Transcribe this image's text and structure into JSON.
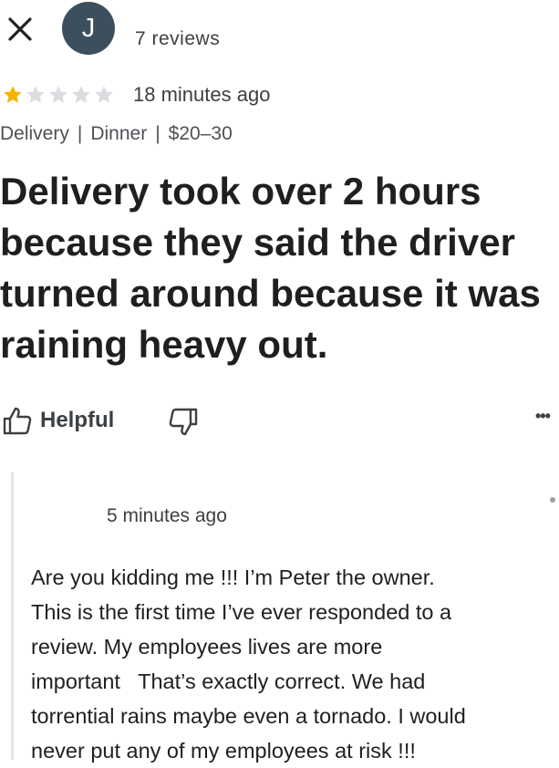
{
  "header": {
    "close_icon": "close-icon",
    "avatar_initial": "J",
    "review_count": "7 reviews"
  },
  "review": {
    "rating": 1,
    "rating_max": 5,
    "star_filled_color": "#f4b400",
    "star_empty_color": "#dadce0",
    "time_ago": "18 minutes ago",
    "tags": [
      "Delivery",
      "Dinner",
      "$20–30"
    ],
    "text_lines": [
      "Delivery took over 2 hours",
      "because they said the driver",
      "turned around because it was",
      "raining heavy out."
    ]
  },
  "actions": {
    "helpful_label": "Helpful",
    "thumb_up_icon": "thumb-up-icon",
    "thumb_down_icon": "thumb-down-icon",
    "more_label": "•••"
  },
  "owner_reply": {
    "time_ago": "5 minutes ago",
    "text_lines": [
      "Are you kidding me !!! I’m Peter the owner.",
      "This is the first time I’ve ever responded to a",
      "review. My employees lives are more",
      "important   That’s exactly correct. We had",
      "torrential rains maybe even a tornado. I would",
      "never put any of my employees at risk !!!"
    ]
  }
}
